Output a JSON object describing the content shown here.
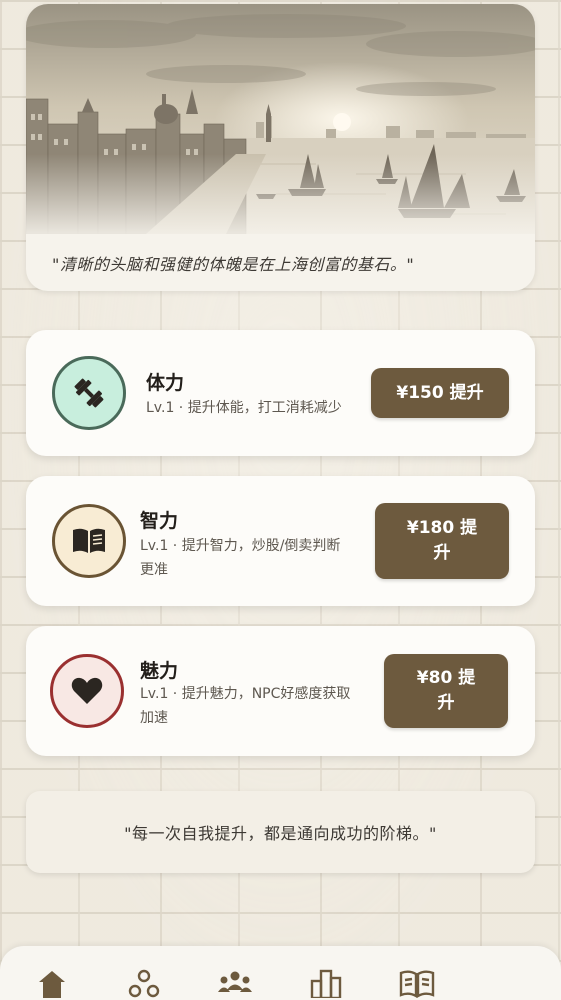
{
  "hero": {
    "quote": "\"清晰的头脑和强健的体魄是在上海创富的基石。\""
  },
  "upgrades": [
    {
      "name": "体力",
      "desc": "Lv.1 · 提升体能，打工消耗减少",
      "button": "¥150 提升",
      "icon": "dumbbell-icon",
      "icon_bg": "#c8eedd",
      "icon_border": "#4a6a5a"
    },
    {
      "name": "智力",
      "desc_line1": "Lv.1 · 提升智力，炒股/倒卖判断",
      "desc_line2": "更准",
      "button_line1": "¥180 提",
      "button_line2": "升",
      "icon": "book-icon",
      "icon_bg": "#f8ecd4",
      "icon_border": "#6a5434"
    },
    {
      "name": "魅力",
      "desc_line1": "Lv.1 · 提升魅力，NPC好感度获取",
      "desc_line2": "加速",
      "button_line1": "¥80 提",
      "button_line2": "升",
      "icon": "heart-icon",
      "icon_bg": "#f8e8e4",
      "icon_border": "#9a3030"
    }
  ],
  "motto": "\"每一次自我提升，都是通向成功的阶梯。\"",
  "nav": [
    "home-icon",
    "network-icon",
    "people-icon",
    "buildings-icon",
    "book-icon"
  ],
  "colors": {
    "button": "#6d5a3e",
    "card": "#fdfcf9"
  }
}
